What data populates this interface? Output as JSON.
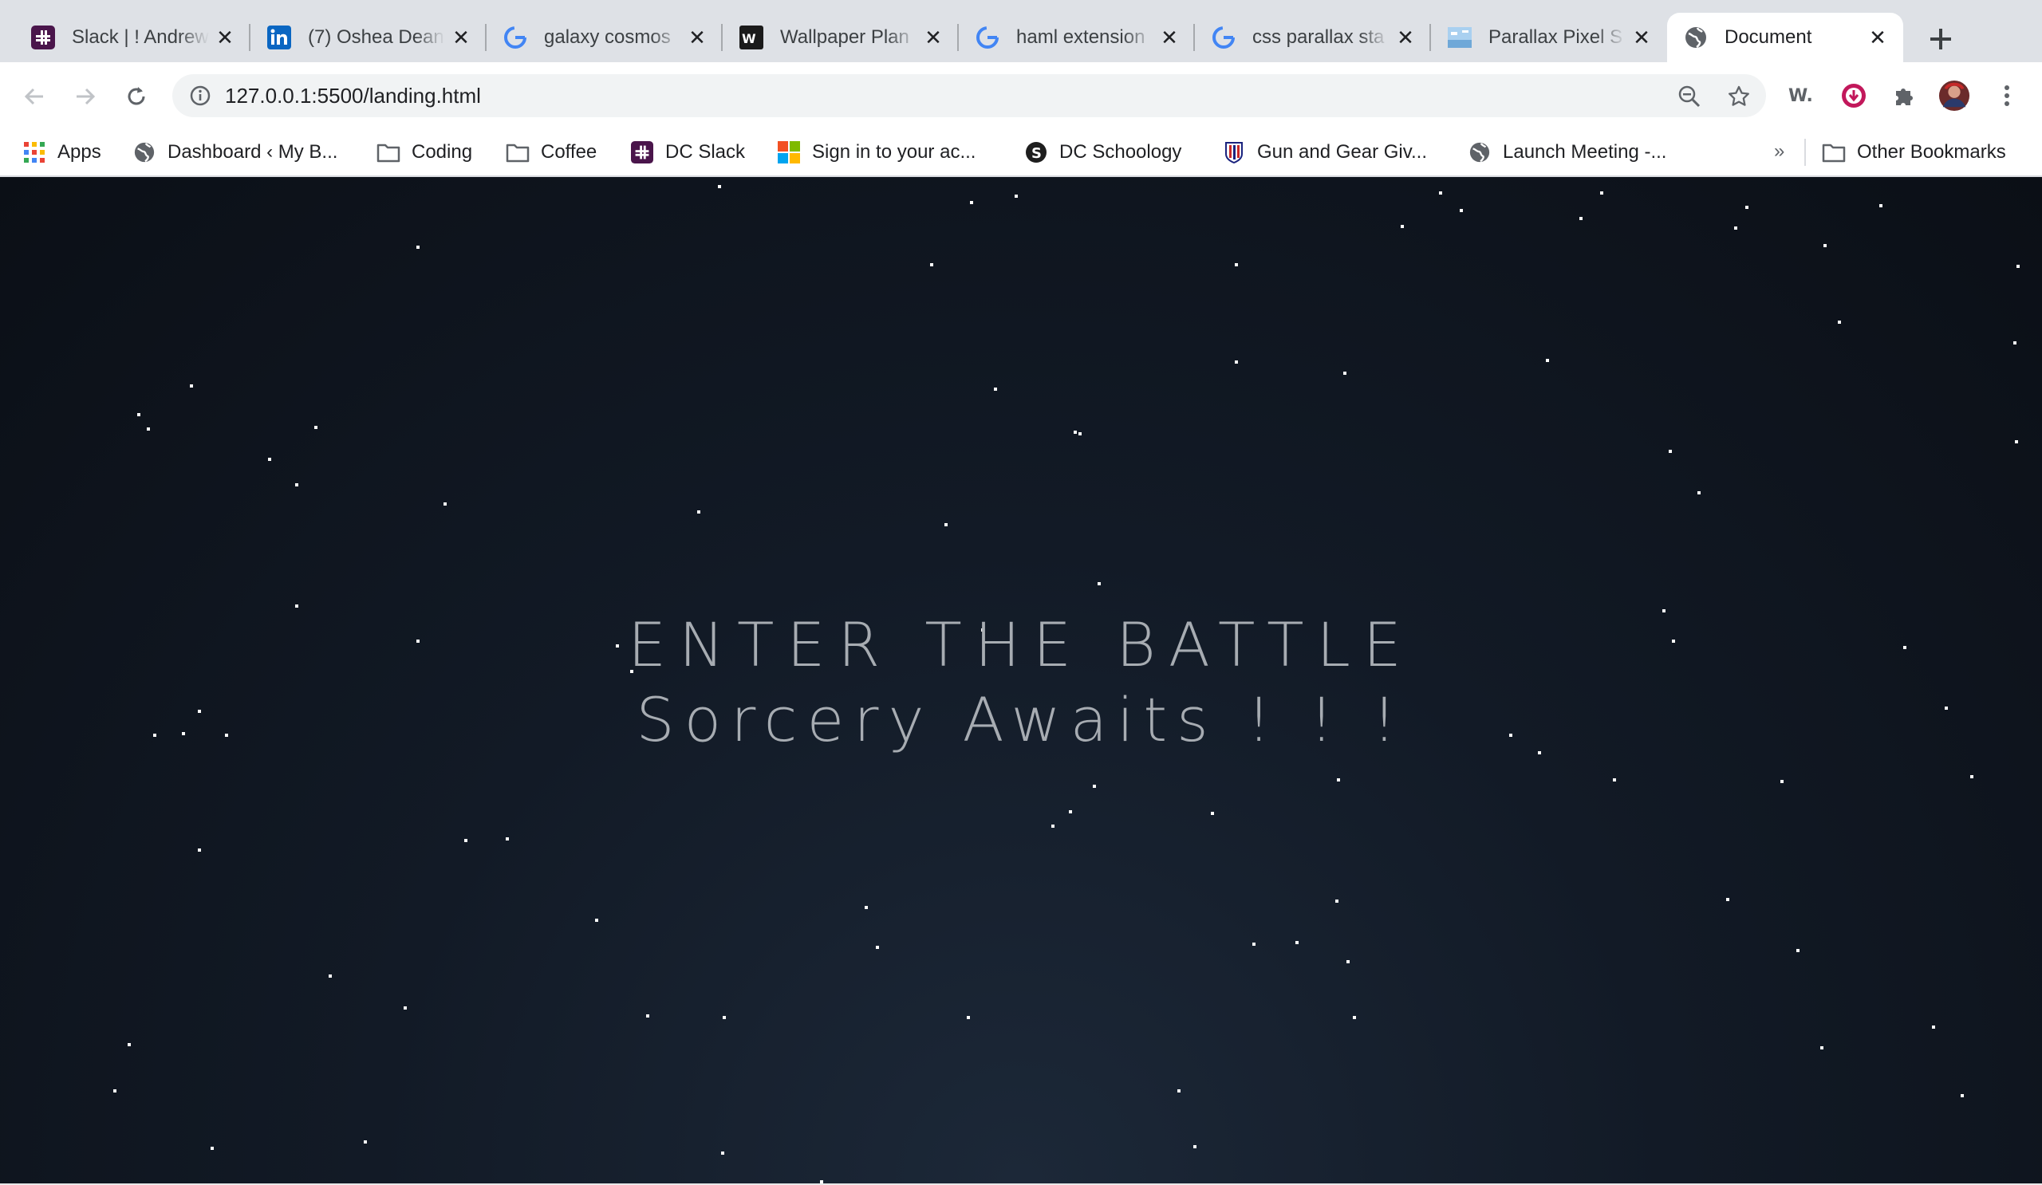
{
  "tabs": [
    {
      "title": "Slack | ! Andrew",
      "icon": "slack-icon",
      "color": "#4a154b"
    },
    {
      "title": "(7) Oshea Dean",
      "icon": "linkedin-icon",
      "color": "#0a66c2"
    },
    {
      "title": "galaxy cosmos",
      "icon": "google-icon",
      "color": "#4285f4"
    },
    {
      "title": "Wallpaper Plan",
      "icon": "wallpaper-icon",
      "color": "#1b1b1b"
    },
    {
      "title": "haml extension",
      "icon": "google-icon",
      "color": "#4285f4"
    },
    {
      "title": "css parallax sta",
      "icon": "google-icon",
      "color": "#4285f4"
    },
    {
      "title": "Parallax Pixel S",
      "icon": "pixel-image-icon",
      "color": "#7fb3e0"
    },
    {
      "title": "Document",
      "icon": "globe-icon",
      "color": "#5f6368"
    }
  ],
  "toolbar": {
    "url": "127.0.0.1:5500/landing.html"
  },
  "bookmarks": {
    "items": [
      {
        "label": "Apps",
        "icon": "apps-grid-icon"
      },
      {
        "label": "Dashboard ‹ My B...",
        "icon": "globe-icon"
      },
      {
        "label": "Coding",
        "icon": "folder-icon"
      },
      {
        "label": "Coffee",
        "icon": "folder-icon"
      },
      {
        "label": "DC Slack",
        "icon": "slack-icon"
      },
      {
        "label": "Sign in to your ac...",
        "icon": "microsoft-icon"
      },
      {
        "label": "DC Schoology",
        "icon": "schoology-icon"
      },
      {
        "label": "Gun and Gear Giv...",
        "icon": "shield-icon"
      },
      {
        "label": "Launch Meeting -...",
        "icon": "globe-icon"
      }
    ],
    "overflow": "»",
    "other": "Other Bookmarks"
  },
  "page": {
    "headline": "ENTER THE BATTLE",
    "subheadline": "Sorcery Awaits ! ! !",
    "background_color": "#121a26",
    "star_color": "#ffffff"
  }
}
